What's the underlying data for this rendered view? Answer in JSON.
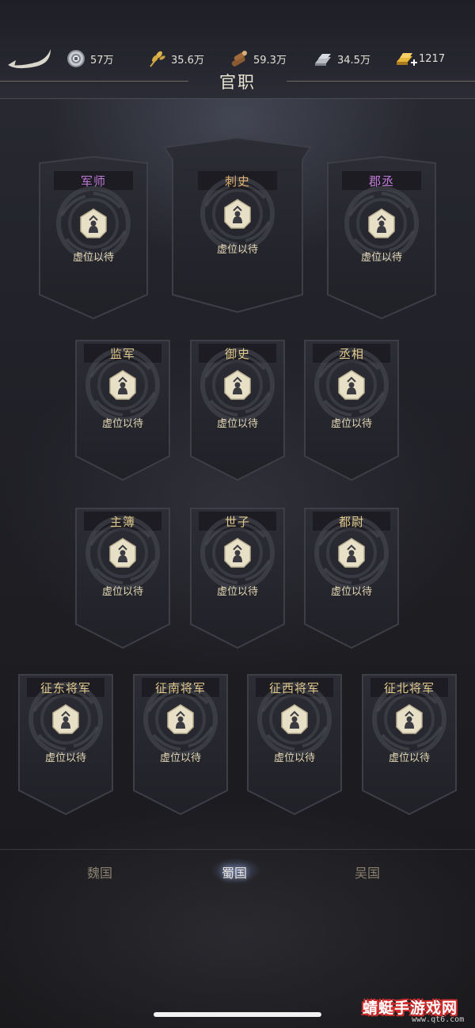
{
  "header": {
    "title": "官职",
    "resources": [
      {
        "icon": "silver-coin-icon",
        "value": "57万"
      },
      {
        "icon": "grain-icon",
        "value": "35.6万"
      },
      {
        "icon": "wood-log-icon",
        "value": "59.3万"
      },
      {
        "icon": "iron-ingot-icon",
        "value": "34.5万"
      },
      {
        "icon": "gold-ingot-add-icon",
        "value": "1217"
      }
    ]
  },
  "positions": {
    "row1": [
      {
        "name": "军师",
        "status": "虚位以待",
        "name_color": "#c07ad8"
      },
      {
        "name": "刺史",
        "status": "虚位以待",
        "name_color": "#e0b070"
      },
      {
        "name": "郡丞",
        "status": "虚位以待",
        "name_color": "#c07ad8"
      }
    ],
    "row2": [
      {
        "name": "监军",
        "status": "虚位以待"
      },
      {
        "name": "御史",
        "status": "虚位以待"
      },
      {
        "name": "丞相",
        "status": "虚位以待"
      }
    ],
    "row3": [
      {
        "name": "主簿",
        "status": "虚位以待"
      },
      {
        "name": "世子",
        "status": "虚位以待"
      },
      {
        "name": "都尉",
        "status": "虚位以待"
      }
    ],
    "row4": [
      {
        "name": "征东将军",
        "status": "虚位以待"
      },
      {
        "name": "征南将军",
        "status": "虚位以待"
      },
      {
        "name": "征西将军",
        "status": "虚位以待"
      },
      {
        "name": "征北将军",
        "status": "虚位以待"
      }
    ]
  },
  "tabs": [
    {
      "label": "魏国",
      "active": false
    },
    {
      "label": "蜀国",
      "active": true
    },
    {
      "label": "吴国",
      "active": false
    }
  ],
  "watermark": {
    "text": "蜻蜓手游戏网",
    "url": "www.qt6.com"
  }
}
